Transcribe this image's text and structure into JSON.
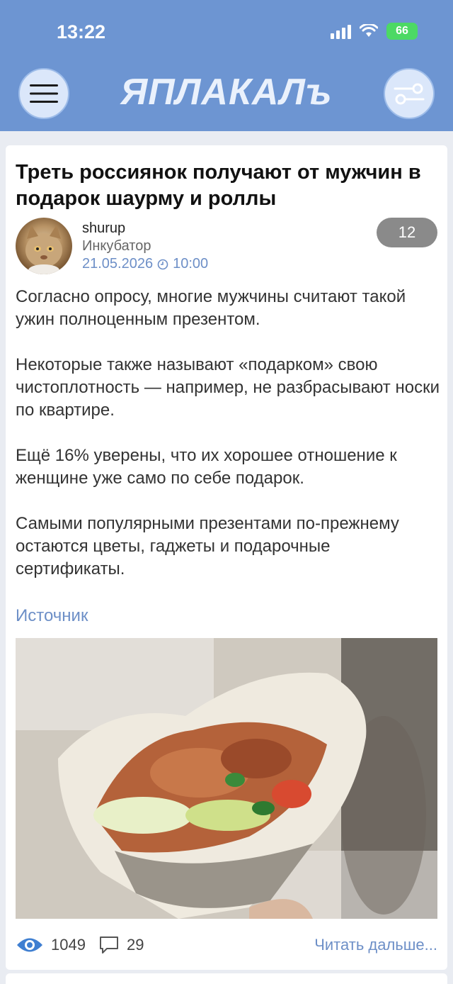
{
  "status_bar": {
    "time": "13:22",
    "battery": "66"
  },
  "header": {
    "logo": "ЯПЛАКАЛъ"
  },
  "post": {
    "title": "Треть россиянок получают от мужчин в подарок шаурму и роллы",
    "author": "shurup",
    "rank": "Инкубатор",
    "date": "21.05.2026",
    "time": "10:00",
    "rating": "12",
    "paragraphs": [
      "Согласно опросу, многие мужчины считают такой ужин полноценным презентом.",
      " Некоторые также называют «подарком» свою чистоплотность — например, не разбрасывают носки по квартире.",
      " Ещё 16% уверены, что их хорошее отношение к женщине уже само по себе подарок.",
      "Самыми популярными презентами по-прежнему остаются цветы, гаджеты и подарочные сертификаты."
    ],
    "source_label": "Источник",
    "views": "1049",
    "comments": "29",
    "read_more": "Читать дальше..."
  },
  "colors": {
    "header_bg": "#6d95d2",
    "link": "#6d8fc7",
    "rating_bg": "#8a8a8a"
  }
}
